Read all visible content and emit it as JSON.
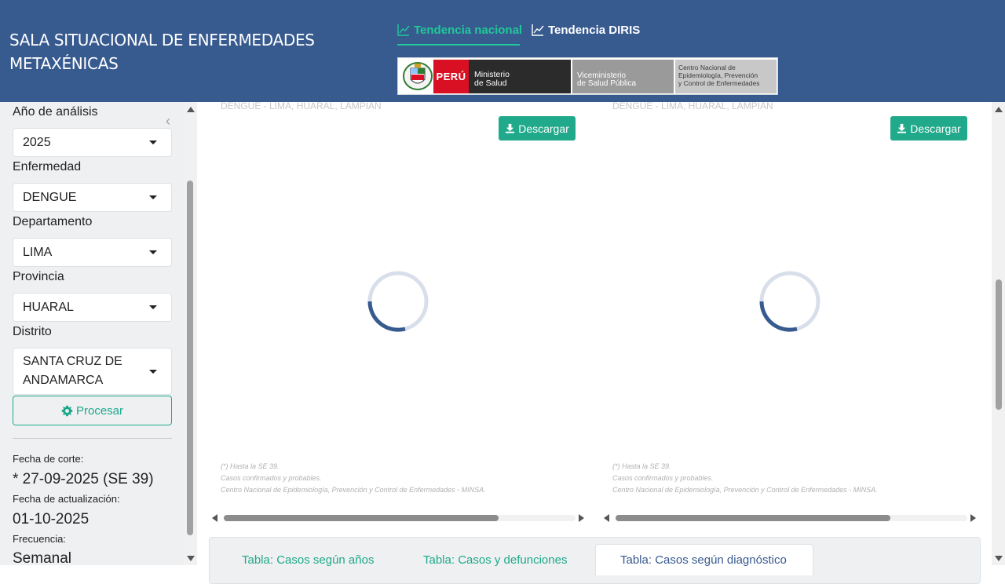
{
  "header": {
    "title": "SALA SITUACIONAL DE ENFERMEDADES METAXÉNICAS",
    "tabs": [
      {
        "label": "Tendencia nacional",
        "icon": "line-chart-icon",
        "active": true
      },
      {
        "label": "Tendencia DIRIS",
        "icon": "line-chart-icon",
        "active": false
      }
    ],
    "logo": {
      "peru": "PERÚ",
      "ministerio": [
        "Ministerio",
        "de Salud"
      ],
      "viceministerio": [
        "Viceministerio",
        "de Salud Pública"
      ],
      "centro": [
        "Centro Nacional de",
        "Epidemiología, Prevención",
        "y Control de Enfermedades"
      ]
    }
  },
  "sidebar": {
    "year": {
      "label": "Año de análisis",
      "value": "2025"
    },
    "disease": {
      "label": "Enfermedad",
      "value": "DENGUE"
    },
    "department": {
      "label": "Departamento",
      "value": "LIMA"
    },
    "province": {
      "label": "Provincia",
      "value": "HUARAL"
    },
    "district": {
      "label": "Distrito",
      "value": "SANTA CRUZ DE ANDAMARCA"
    },
    "process_label": "Procesar",
    "cutoff_label": "Fecha de corte:",
    "cutoff_value": "* 27-09-2025 (SE 39)",
    "update_label": "Fecha de actualización:",
    "update_value": "01-10-2025",
    "frequency_label": "Frecuencia:",
    "frequency_value": "Semanal"
  },
  "panels": [
    {
      "subtitle": "DENGUE - LIMA, HUARAL, LAMPIAN",
      "download_label": "Descargar",
      "notes": [
        "(*) Hasta la SE 39.",
        "Casos confirmados y probables.",
        "Centro Nacional de Epidemiología, Prevención y Control de Enfermedades - MINSA."
      ]
    },
    {
      "subtitle": "DENGUE - LIMA, HUARAL, LAMPIAN",
      "download_label": "Descargar",
      "notes": [
        "(*) Hasta la SE 39.",
        "Casos confirmados y probables.",
        "Centro Nacional de Epidemiología, Prevención y Control de Enfermedades - MINSA."
      ]
    }
  ],
  "table_tabs": [
    {
      "label": "Tabla: Casos según años"
    },
    {
      "label": "Tabla: Casos y defunciones"
    },
    {
      "label": "Tabla: Casos según diagnóstico"
    }
  ],
  "colors": {
    "header_bg": "#375a8f",
    "accent": "#20a98a",
    "active_nav": "#20c997"
  }
}
